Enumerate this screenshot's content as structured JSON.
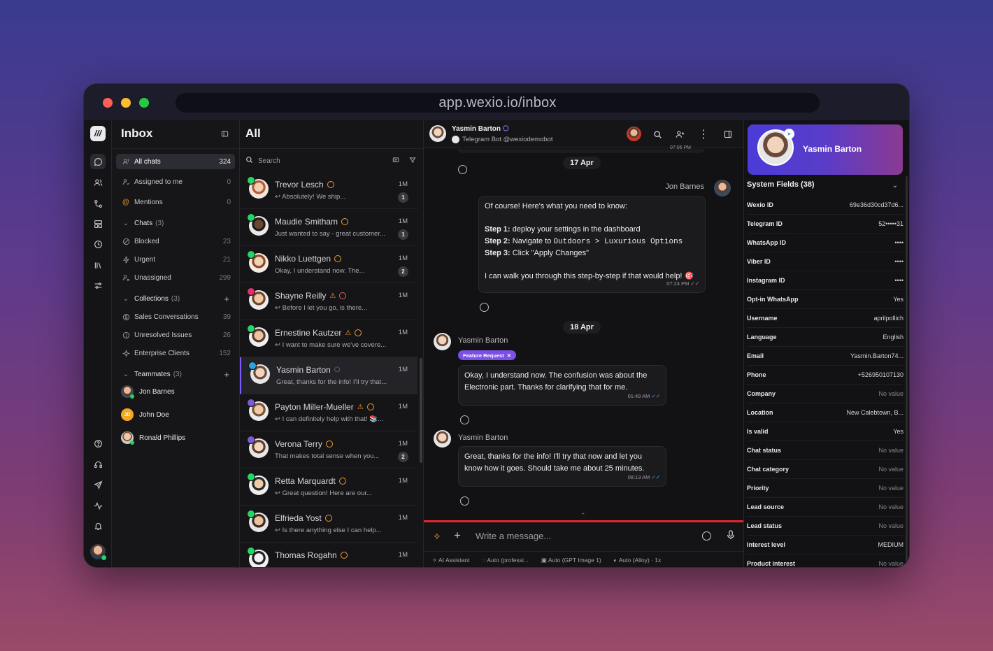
{
  "browser": {
    "url": "app.wexio.io/inbox"
  },
  "nav": {
    "title": "Inbox",
    "items": [
      {
        "label": "All chats",
        "count": "324"
      },
      {
        "label": "Assigned to me",
        "count": "0"
      },
      {
        "label": "Mentions",
        "count": "0"
      }
    ],
    "chats_group": {
      "label": "Chats",
      "sub": "(3)"
    },
    "chats": [
      {
        "label": "Blocked",
        "count": "23"
      },
      {
        "label": "Urgent",
        "count": "21"
      },
      {
        "label": "Unassigned",
        "count": "299"
      }
    ],
    "collections_group": {
      "label": "Collections",
      "sub": "(3)"
    },
    "collections": [
      {
        "label": "Sales Conversations",
        "count": "39"
      },
      {
        "label": "Unresolved Issues",
        "count": "26"
      },
      {
        "label": "Enterprise Clients",
        "count": "152"
      }
    ],
    "teammates_group": {
      "label": "Teammates",
      "sub": "(3)"
    },
    "teammates": [
      {
        "name": "Jon Barnes"
      },
      {
        "name": "John Doe",
        "initials": "JD"
      },
      {
        "name": "Ronald Phillips"
      }
    ]
  },
  "list": {
    "title": "All",
    "search_placeholder": "Search",
    "chats": [
      {
        "name": "Trevor Lesch",
        "preview": "Absolutely! We ship...",
        "time": "1M",
        "badge": "1"
      },
      {
        "name": "Maudie Smitham",
        "preview": "Just wanted to say - great customer...",
        "time": "1M",
        "badge": "1"
      },
      {
        "name": "Nikko Luettgen",
        "preview": "Okay, I understand now. The...",
        "time": "1M",
        "badge": "2"
      },
      {
        "name": "Shayne Reilly",
        "preview": "Before I let you go, is there...",
        "time": "1M",
        "badge": ""
      },
      {
        "name": "Ernestine Kautzer",
        "preview": "I want to make sure we've covere...",
        "time": "1M",
        "badge": ""
      },
      {
        "name": "Yasmin Barton",
        "preview": "Great, thanks for the info! I'll try that...",
        "time": "1M",
        "badge": ""
      },
      {
        "name": "Payton Miller-Mueller",
        "preview": "I can definitely help with that! 📚...",
        "time": "1M",
        "badge": ""
      },
      {
        "name": "Verona Terry",
        "preview": "That makes total sense when you...",
        "time": "1M",
        "badge": "2"
      },
      {
        "name": "Retta Marquardt",
        "preview": "Great question! Here are our...",
        "time": "1M",
        "badge": ""
      },
      {
        "name": "Elfrieda Yost",
        "preview": "Is there anything else I can help...",
        "time": "1M",
        "badge": ""
      },
      {
        "name": "Thomas Rogahn",
        "preview": "",
        "time": "1M",
        "badge": ""
      }
    ]
  },
  "conversation": {
    "contact_name": "Yasmin Barton",
    "contact_sub": "Telegram Bot @wexiodemobot",
    "clipped_time": "07:06 PM",
    "date1": "17 Apr",
    "agent_name": "Jon Barnes",
    "agent_msg": {
      "intro": "Of course! Here's what you need to know:",
      "s1b": "Step 1:",
      "s1": " deploy your settings in the dashboard",
      "s2b": "Step 2:",
      "s2": " Navigate to ",
      "s2code": "Outdoors > Luxurious Options",
      "s3b": "Step 3:",
      "s3": " Click \"Apply Changes\"",
      "outro": "I can walk you through this step-by-step if that would help! 🎯",
      "time": "07:24 PM"
    },
    "date2": "18 Apr",
    "msg1": {
      "sender": "Yasmin Barton",
      "tag": "Feature Request",
      "text": "Okay, I understand now. The confusion was about the Electronic part. Thanks for clarifying that for me.",
      "time": "01:49 AM"
    },
    "msg2": {
      "sender": "Yasmin Barton",
      "text": "Great, thanks for the info! I'll try that now and let you know how it goes. Should take me about 25 minutes.",
      "time": "08:13 AM"
    },
    "compose_placeholder": "Write a message...",
    "toolbar": [
      "AI Assistant",
      "Auto (professi...",
      "Auto (GPT Image 1)",
      "Auto (Alloy) · 1x"
    ]
  },
  "details": {
    "name": "Yasmin Barton",
    "section": "System Fields (38)",
    "fields": [
      {
        "k": "Wexio ID",
        "v": "69e36d30cd37d6..."
      },
      {
        "k": "Telegram ID",
        "v": "52•••••31"
      },
      {
        "k": "WhatsApp ID",
        "v": "••••"
      },
      {
        "k": "Viber ID",
        "v": "••••"
      },
      {
        "k": "Instagram ID",
        "v": "••••"
      },
      {
        "k": "Opt-in WhatsApp",
        "v": "Yes"
      },
      {
        "k": "Username",
        "v": "aprilpollich"
      },
      {
        "k": "Language",
        "v": "English"
      },
      {
        "k": "Email",
        "v": "Yasmin.Barton74..."
      },
      {
        "k": "Phone",
        "v": "+526950107130"
      },
      {
        "k": "Company",
        "v": "No value"
      },
      {
        "k": "Location",
        "v": "New Calebtown, B..."
      },
      {
        "k": "Is valid",
        "v": "Yes"
      },
      {
        "k": "Chat status",
        "v": "No value"
      },
      {
        "k": "Chat category",
        "v": "No value"
      },
      {
        "k": "Priority",
        "v": "No value"
      },
      {
        "k": "Lead source",
        "v": "No value"
      },
      {
        "k": "Lead status",
        "v": "No value"
      },
      {
        "k": "Interest level",
        "v": "MEDIUM"
      },
      {
        "k": "Product interest",
        "v": "No value"
      }
    ]
  },
  "colors": {
    "accent": "#7c5cff",
    "danger": "#e0282e",
    "warning": "#f39c32",
    "whatsapp": "#25d366",
    "telegram": "#2aa3e0",
    "viber": "#7b5cd6",
    "instagram": "#e1306c"
  }
}
